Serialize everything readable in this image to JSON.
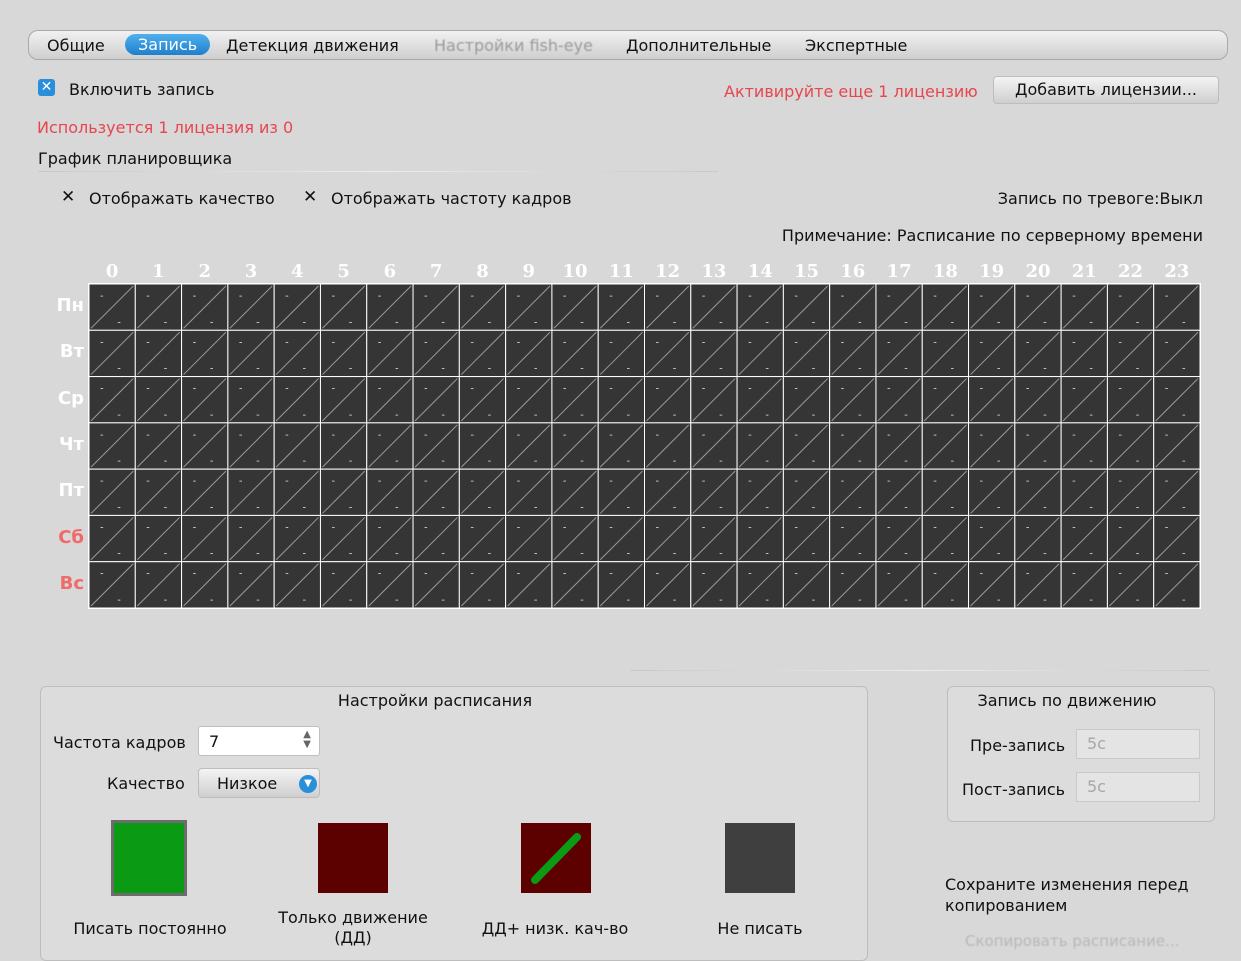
{
  "tabs": [
    {
      "label": "Общие",
      "state": "normal"
    },
    {
      "label": "Запись",
      "state": "active"
    },
    {
      "label": "Детекция движения",
      "state": "normal"
    },
    {
      "label": "Настройки fish-eye",
      "state": "disabled"
    },
    {
      "label": "Дополнительные",
      "state": "normal"
    },
    {
      "label": "Экспертные",
      "state": "normal"
    }
  ],
  "recording": {
    "enable_label": "Включить запись",
    "enabled": true,
    "activate_notice": "Активируйте еще 1 лицензию",
    "add_licenses_label": "Добавить лицензии...",
    "license_usage": "Используется 1 лицензия из 0"
  },
  "scheduler": {
    "title": "График планировщика",
    "show_quality_label": "Отображать качество",
    "show_fps_label": "Отображать частоту кадров",
    "alarm_record": "Запись по тревоге:Выкл",
    "note": "Примечание: Расписание по серверному времени",
    "hours": [
      "0",
      "1",
      "2",
      "3",
      "4",
      "5",
      "6",
      "7",
      "8",
      "9",
      "10",
      "11",
      "12",
      "13",
      "14",
      "15",
      "16",
      "17",
      "18",
      "19",
      "20",
      "21",
      "22",
      "23"
    ],
    "days": [
      {
        "label": "Пн",
        "weekend": false
      },
      {
        "label": "Вт",
        "weekend": false
      },
      {
        "label": "Ср",
        "weekend": false
      },
      {
        "label": "Чт",
        "weekend": false
      },
      {
        "label": "Пт",
        "weekend": false
      },
      {
        "label": "Сб",
        "weekend": true
      },
      {
        "label": "Вс",
        "weekend": true
      }
    ],
    "cell_value": "-"
  },
  "schedule_settings": {
    "title": "Настройки расписания",
    "fps_label": "Частота кадров",
    "fps_value": "7",
    "quality_label": "Качество",
    "quality_value": "Низкое",
    "modes": [
      {
        "label": "Писать постоянно",
        "color": "#0a9a14"
      },
      {
        "label": "Только движение (ДД)",
        "color": "#5c0000"
      },
      {
        "label": "ДД+ низк. кач-во",
        "color": "#5c0000"
      },
      {
        "label": "Не писать",
        "color": "#3f3f3f"
      }
    ]
  },
  "motion_record": {
    "title": "Запись по движению",
    "pre_label": "Пре-запись",
    "pre_value": "5с",
    "post_label": "Пост-запись",
    "post_value": "5с"
  },
  "copy": {
    "notice": "Сохраните изменения перед копированием",
    "button_label": "Скопировать расписание..."
  }
}
